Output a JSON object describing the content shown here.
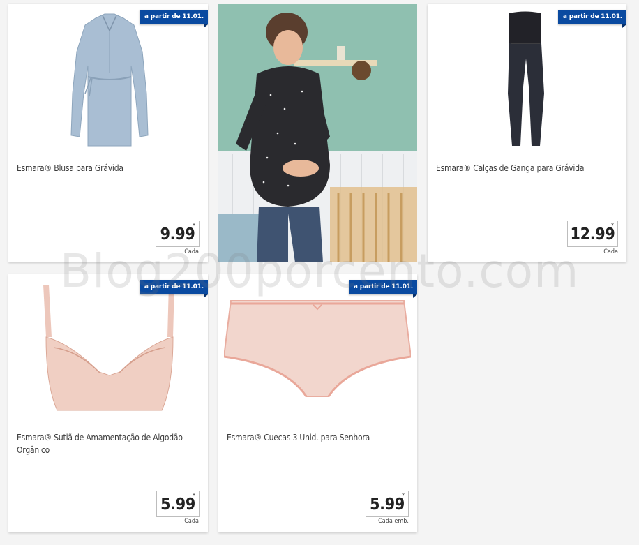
{
  "products": [
    {
      "name": "Esmara® Blusa para Grávida",
      "badge": "a partir de 11.01.",
      "price": "9.99",
      "asterisk": "*",
      "unit": "Cada"
    },
    {
      "name": "Esmara® Calças de Ganga para Grávida",
      "badge": "a partir de 11.01.",
      "price": "12.99",
      "asterisk": "*",
      "unit": "Cada"
    },
    {
      "name": "Esmara® Sutiã de Amamentação de Algodão Orgânico",
      "badge": "a partir de 11.01.",
      "price": "5.99",
      "asterisk": "*",
      "unit": "Cada"
    },
    {
      "name": "Esmara® Cuecas 3 Unid. para Senhora",
      "badge": "a partir de 11.01.",
      "price": "5.99",
      "asterisk": "*",
      "unit": "Cada emb."
    }
  ],
  "watermark": "Blog200porcento.com",
  "icons": {
    "blouse": "maternity-blouse-image",
    "jeans": "maternity-jeans-image",
    "bra": "nursing-bra-image",
    "briefs": "briefs-image",
    "promo": "pregnant-woman-photo"
  },
  "colors": {
    "badge": "#0a4aa0",
    "background": "#f4f4f4"
  }
}
